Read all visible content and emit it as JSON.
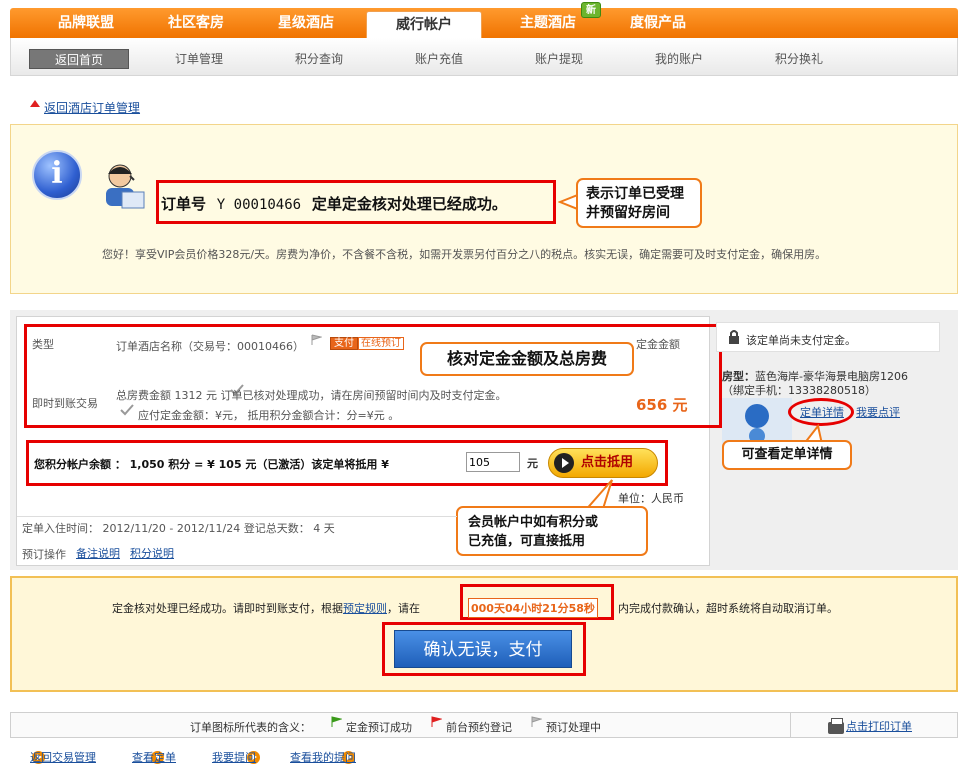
{
  "topnav": {
    "tabs": [
      "品牌联盟",
      "社区客房",
      "星级酒店",
      "威行帐户",
      "主题酒店",
      "度假产品"
    ],
    "new_badge": "新"
  },
  "subnav": {
    "items": [
      "返回首页",
      "订单管理",
      "积分查询",
      "账户充值",
      "账户提现",
      "我的账户",
      "积分换礼"
    ]
  },
  "back_link": "返回酒店订单管理",
  "info": {
    "order_label": "订单号",
    "order_no": "Y 00010466",
    "status": "定单定金核对处理已经成功。",
    "callout": "表示订单已受理\n并预留好房间",
    "message": "您好！享受VIP会员价格328元/天。房费为净价，不含餐不含税，如需开发票另付百分之八的税点。核实无误，确定需要可及时支付定金，确保用房。"
  },
  "order": {
    "row1_type": "类型",
    "row1_hotel": "订单酒店名称（交易号：00010466）",
    "stamp": "支付",
    "stamp_online": "在线预订",
    "row1_right": "定金金额",
    "callout_amount": "核对定金金额及总房费",
    "row2_type": "即时到账交易",
    "total_line": "总房费金额  1312 元   订单已核对处理成功，请在房间预留时间内及时支付定金。",
    "deposit_line": "应付定金金额：¥元，  抵用积分金额合计：分=¥元 。",
    "deposit_amount": "656 元",
    "points_line": "您积分帐户余额 ： 1,050 积分 = ¥ 105 元（已激活）该定单将抵用 ¥",
    "points_input": "105",
    "points_unit": "元",
    "points_button": "点击抵用",
    "currency_unit": "单位：人民币",
    "callout_points": "会员帐户中如有积分或\n已充值，可直接抵用",
    "stay_dates": "定单入住时间：  2012/11/20 - 2012/11/24  登记总天数： 4 天",
    "ops_label": "预订操作",
    "ops_links": [
      "备注说明",
      "积分说明"
    ]
  },
  "side": {
    "notice": "该定单尚未支付定金。",
    "room_label": "房型：",
    "room_name": "蓝色海岸-豪华海景电脑房1206",
    "phone": "（绑定手机：13338280518）",
    "detail_link": "定单详情",
    "review_link": "我要点评",
    "callout_detail": "可查看定单详情"
  },
  "confirm": {
    "text_before": "定金核对处理已经成功。请即时到账支付，根据",
    "rule_link": "预定规则",
    "text_mid": "，请在",
    "countdown": "000天04小时21分58秒",
    "text_after": "内完成付款确认，超时系统将自动取消订单。",
    "pay_button": "确认无误，支付"
  },
  "legend": {
    "label": "订单图标所代表的含义：",
    "items": [
      "定金预订成功",
      "前台预约登记",
      "预订处理中"
    ],
    "print_link": "点击打印订单",
    "colors": {
      "green": "#3a9a1a",
      "red": "#e02020",
      "grey": "#999999"
    }
  },
  "footer_links": [
    "返回交易管理",
    "查看定单",
    "我要提问",
    "查看我的提问"
  ]
}
